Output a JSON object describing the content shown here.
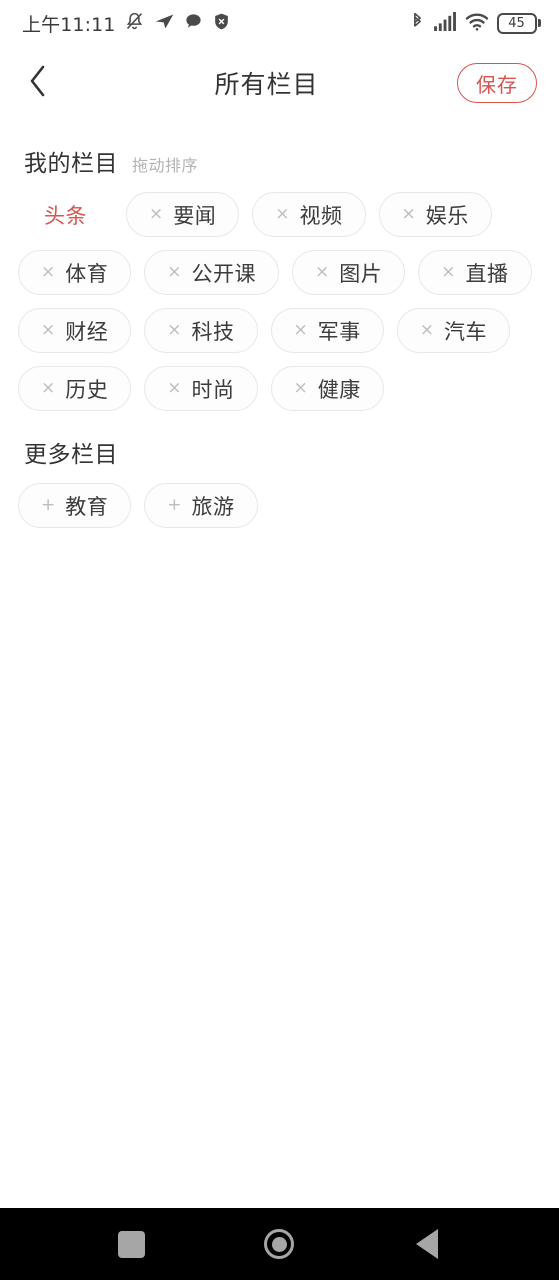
{
  "status_bar": {
    "clock": "上午11:11",
    "left_icons": [
      "bell-muted-icon",
      "send-icon",
      "chat-bubble-icon",
      "shield-icon"
    ],
    "right_icons": [
      "bluetooth-icon",
      "signal-bars-icon",
      "wifi-icon"
    ],
    "battery_level": "45"
  },
  "header": {
    "back_icon": "chevron-left-icon",
    "title": "所有栏目",
    "save_label": "保存",
    "save_color": "#d9534f"
  },
  "my_columns": {
    "title": "我的栏目",
    "subtitle": "拖动排序",
    "items": [
      {
        "label": "头条",
        "mark": "",
        "fixed": true
      },
      {
        "label": "要闻",
        "mark": "×",
        "fixed": false
      },
      {
        "label": "视频",
        "mark": "×",
        "fixed": false
      },
      {
        "label": "娱乐",
        "mark": "×",
        "fixed": false
      },
      {
        "label": "体育",
        "mark": "×",
        "fixed": false
      },
      {
        "label": "公开课",
        "mark": "×",
        "fixed": false
      },
      {
        "label": "图片",
        "mark": "×",
        "fixed": false
      },
      {
        "label": "直播",
        "mark": "×",
        "fixed": false
      },
      {
        "label": "财经",
        "mark": "×",
        "fixed": false
      },
      {
        "label": "科技",
        "mark": "×",
        "fixed": false
      },
      {
        "label": "军事",
        "mark": "×",
        "fixed": false
      },
      {
        "label": "汽车",
        "mark": "×",
        "fixed": false
      },
      {
        "label": "历史",
        "mark": "×",
        "fixed": false
      },
      {
        "label": "时尚",
        "mark": "×",
        "fixed": false
      },
      {
        "label": "健康",
        "mark": "×",
        "fixed": false
      }
    ]
  },
  "more_columns": {
    "title": "更多栏目",
    "items": [
      {
        "label": "教育",
        "mark": "+"
      },
      {
        "label": "旅游",
        "mark": "+"
      }
    ]
  },
  "nav_bar": {
    "recents_icon": "square-icon",
    "home_icon": "circle-icon",
    "back_icon": "triangle-left-icon"
  }
}
